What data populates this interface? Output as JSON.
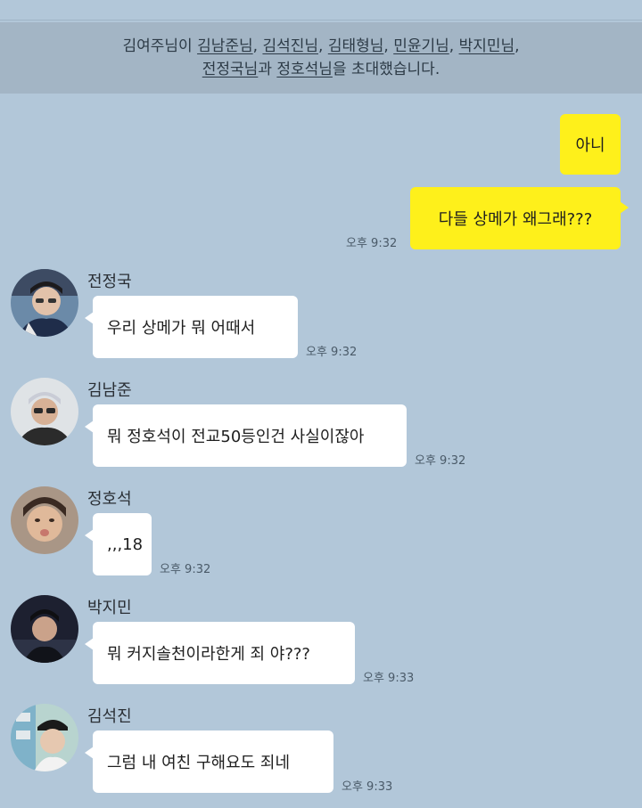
{
  "system_notice": {
    "line1_prefix": "김여주님이 ",
    "invitees": [
      "김남준님",
      "김석진님",
      "김태형님",
      "민윤기님",
      "박지민님",
      "전정국님",
      "정호석님"
    ],
    "line1_sep": ", ",
    "line2_conj": "과 ",
    "line2_suffix": "을 초대했습니다."
  },
  "messages": [
    {
      "side": "out",
      "text": "아니",
      "time": ""
    },
    {
      "side": "out",
      "text": "다들 상메가 왜그래???",
      "time": "오후 9:32"
    },
    {
      "side": "in",
      "sender": "전정국",
      "avatar": "avatar-jeongguk",
      "text": "우리 상메가 뭐 어때서",
      "time": "오후 9:32"
    },
    {
      "side": "in",
      "sender": "김남준",
      "avatar": "avatar-namjoon",
      "text": "뭐 정호석이 전교50등인건 사실이잖아",
      "time": "오후 9:32"
    },
    {
      "side": "in",
      "sender": "정호석",
      "avatar": "avatar-hoseok",
      "text": ",,,18",
      "time": "오후 9:32"
    },
    {
      "side": "in",
      "sender": "박지민",
      "avatar": "avatar-jimin",
      "text": "뭐 커지솔천이라한게 죄 야???",
      "time": "오후 9:33"
    },
    {
      "side": "in",
      "sender": "김석진",
      "avatar": "avatar-seokjin",
      "text": "그럼 내 여친 구해요도 죄네",
      "time": "오후 9:33"
    }
  ],
  "colors": {
    "background": "#b2c7d9",
    "notice_bg": "#a3b5c5",
    "my_bubble": "#fef01b",
    "their_bubble": "#ffffff"
  }
}
